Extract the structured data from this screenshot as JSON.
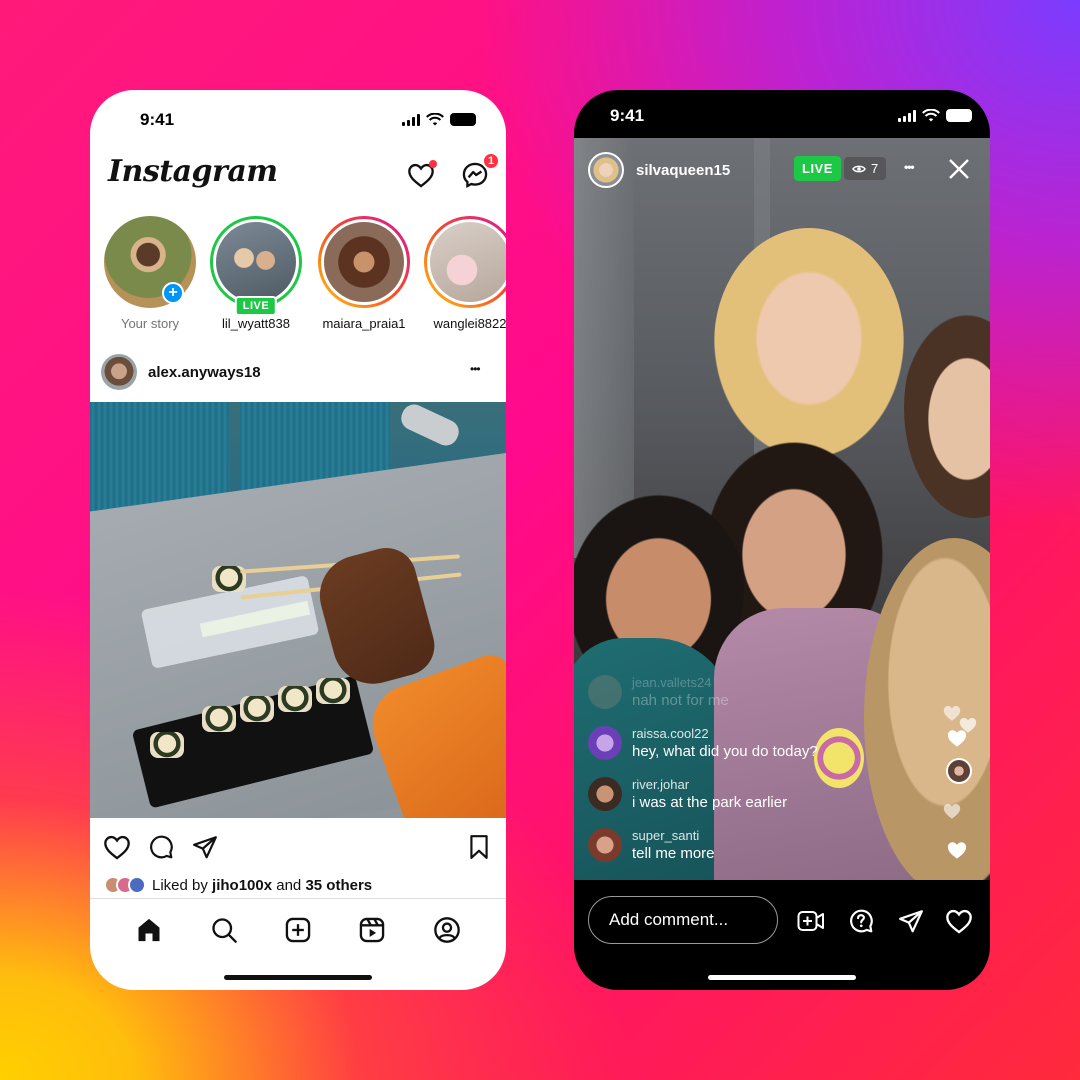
{
  "colors": {
    "live_green": "#1cc845",
    "notification_red": "#ff3040",
    "link_blue": "#0095f6",
    "story_ring_gradient": [
      "#fdc70b",
      "#f74a2b",
      "#d3169c"
    ]
  },
  "feed_phone": {
    "status_bar": {
      "time": "9:41"
    },
    "header": {
      "logo_text": "Instagram",
      "icons": [
        "heart-icon",
        "messenger-icon"
      ],
      "messenger_badge": "1"
    },
    "stories": [
      {
        "label": "Your story",
        "ring": "none",
        "badge": "+"
      },
      {
        "label": "lil_wyatt838",
        "ring": "live",
        "tag": "LIVE"
      },
      {
        "label": "maiara_praia1",
        "ring": "gradient"
      },
      {
        "label": "wanglei8822",
        "ring": "gradient"
      }
    ],
    "post": {
      "username": "alex.anyways18",
      "more_glyph": "•••",
      "liked_prefix": "Liked by ",
      "liked_user": "jiho100x",
      "liked_mid": " and ",
      "liked_others": "35 others"
    },
    "tab_bar": [
      "home-icon",
      "search-icon",
      "create-icon",
      "reels-icon",
      "profile-icon"
    ]
  },
  "live_phone": {
    "status_bar": {
      "time": "9:41"
    },
    "header": {
      "username": "silvaqueen15",
      "live_label": "LIVE",
      "viewer_count": "7",
      "more_glyph": "•••"
    },
    "comments": [
      {
        "user": "jean.vallets24",
        "text": "nah not for me",
        "faded": true
      },
      {
        "user": "raissa.cool22",
        "text": "hey, what did you do today?"
      },
      {
        "user": "river.johar",
        "text": "i was at the park earlier"
      },
      {
        "user": "super_santi",
        "text": "tell me more"
      }
    ],
    "comment_placeholder": "Add comment...",
    "bottom_icons": [
      "add-guest-icon",
      "question-icon",
      "share-icon",
      "heart-icon"
    ]
  }
}
